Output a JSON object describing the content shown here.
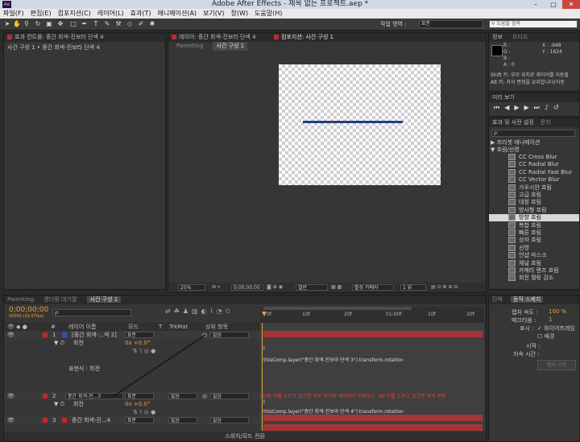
{
  "app": {
    "title": "Adobe After Effects - 제목 없는 프로젝트.aep *",
    "logo": "Ae",
    "win_min": "–",
    "win_max": "□",
    "win_close": "✕"
  },
  "menu": [
    "파일(F)",
    "편집(E)",
    "컴포지션(C)",
    "레이어(L)",
    "효과(T)",
    "애니메이션(A)",
    "보기(V)",
    "창(W)",
    "도움말(H)"
  ],
  "toolbar": {
    "workspace_label": "작업 영역 :",
    "workspace_value": "표준",
    "search_placeholder": "도움말 검색"
  },
  "effect_controls": {
    "tab": "효과 컨트롤: 중간 회색-진보라 단색 4",
    "subtitle": "사건 구성 1 • 중간 회색-진보라 단색 4"
  },
  "viewer": {
    "tabs": [
      "레이어: 중간 회색-진보라 단색 4",
      "컴포지션: 사건 구성 1"
    ],
    "subtabs": [
      "Parenting",
      "사건 구성 1"
    ],
    "zoom": "25%",
    "timecode": "0;00;00;00",
    "resolution": "절반",
    "camera": "활성 카메라",
    "views": "1 뷰"
  },
  "info": {
    "tabs": [
      "정보",
      "오디오"
    ],
    "r": "R :",
    "g": "G :",
    "b": "B :",
    "a": "A : 0",
    "x": "X : -948",
    "y": "Y : 1624",
    "hint1": "Shift 키: 부모 위치로 레이어를 이동할",
    "hint2": "Alt 키: 자식 변형을 유지합니다(이동"
  },
  "preview": {
    "tab": "미리 보기"
  },
  "effects_presets": {
    "tabs": [
      "효과 및 사전 설정",
      "문자"
    ],
    "search_placeholder": "ρ·",
    "groups": [
      "▶ 프리셋 애니메이션",
      "▼ 흐림/선명"
    ],
    "items": [
      "CC Cross Blur",
      "CC Radial Blur",
      "CC Radial Fast Blur",
      "CC Vector Blur",
      "가우시안 흐림",
      "고급 흐림",
      "대칭 흐림",
      "방사형 흐림",
      "방향 흐림",
      "복합 흐림",
      "빠른 흐림",
      "상자 흐림",
      "선명",
      "언샵 마스크",
      "채널 흐림",
      "카메라 렌즈 흐림",
      "회전 월링 감소"
    ],
    "selected_index": 8
  },
  "timeline": {
    "tabs": [
      "Parenting",
      "렌더링 대기열",
      "사건 구성 1"
    ],
    "timecode": "0;00;00;00",
    "fps": "00000 (29.97fps)",
    "search_placeholder": "ρ·",
    "columns": [
      "#",
      "레이어 이름",
      "모드",
      "T",
      "TrkMat",
      "상위 항목"
    ],
    "ruler": [
      "0f",
      "10f",
      "20f",
      "01:00f",
      "10f",
      "20f"
    ],
    "layers": [
      {
        "num": "1",
        "name": "[중간 회색-...색 2]",
        "mode": "표준",
        "parent": "없음",
        "color": "#2d55b8"
      },
      {
        "num": "2",
        "name": "중간 회색-진...3",
        "mode": "표준",
        "trk": "없음",
        "parent": "없음",
        "color": "#c8262b"
      },
      {
        "num": "3",
        "name": "중간 회색-진...4",
        "mode": "표준",
        "trk": "없음",
        "parent": "없음",
        "color": "#c8262b"
      }
    ],
    "rotation_label": "회전",
    "rotation_value": "0x +0.0°",
    "expr_label": "표현식 : 회전",
    "expr1": "thisComp.layer(\"중간 회색-진보라 단색 3\").transform.rotation",
    "expr2": "thisComp.layer(\"중간 회색-진보라 단색 4\").transform.rotation",
    "warning": "Shift 키를 누르고 있으면 부모 위치로 레이어가 이동하고, Alt 키를 누르고 있으면 자식 변형",
    "footer": "스위치/모드 전환",
    "expr_marker": "I"
  },
  "paragraph": {
    "tabs": [
      "단락",
      "동작 스케치"
    ],
    "speed_label": "캡처 속도 :",
    "speed_value": "100 %",
    "smooth_label": "매끄러움 :",
    "smooth_value": "1",
    "show_label": "표시 :",
    "wireframe": "와이어프레임",
    "background": "배경",
    "start_label": "시작 :",
    "duration_label": "지속 시간 :",
    "capture_button": "캡처 시작"
  }
}
